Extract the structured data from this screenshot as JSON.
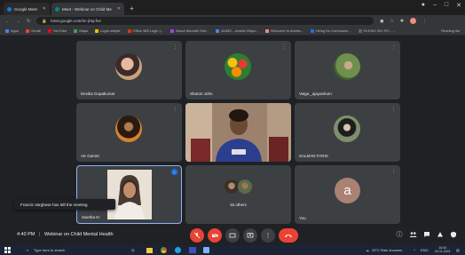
{
  "browser": {
    "tabs": [
      {
        "label": "Google Meet",
        "color": "#1a73e8"
      },
      {
        "label": "Meet - Webinar on Child Me",
        "color": "#00897b",
        "active": true
      }
    ],
    "new_tab": "+",
    "url": "meet.google.com/rtc-jhtq-fve",
    "bookmarks": [
      {
        "label": "Apps",
        "color": "#4285f4"
      },
      {
        "label": "Gmail",
        "color": "#ea4335"
      },
      {
        "label": "YouTube",
        "color": "#ff0000"
      },
      {
        "label": "Maps",
        "color": "#34a853"
      },
      {
        "label": "Login simple",
        "color": "#fbbc04"
      },
      {
        "label": "Office 365 Login |...",
        "color": "#d83b01"
      },
      {
        "label": "About Moonkit Onli...",
        "color": "#a142f4"
      },
      {
        "label": "AUMS – Amrita Vidya...",
        "color": "#4285f4"
      },
      {
        "label": "Welcome to Amrita...",
        "color": "#f28b82"
      },
      {
        "label": "Hiring for Communic...",
        "color": "#1a73e8"
      },
      {
        "label": "HI-ENG 001 IPC - ...",
        "color": "#5f6368"
      }
    ],
    "reading_list": "Reading list"
  },
  "participants": [
    {
      "name": "Devika Gopakumar"
    },
    {
      "name": "Sharon John"
    },
    {
      "name": "Vaiga _ajayashum"
    },
    {
      "name": "AK Gamer"
    },
    {
      "name": ""
    },
    {
      "name": "SALMAN FARIS"
    },
    {
      "name": "Swetha Kr"
    },
    {
      "name": "46 others"
    },
    {
      "name": "You",
      "initial": "a"
    }
  ],
  "toast": "Francis Varghese has left the meeting",
  "meeting": {
    "time": "4:40 PM",
    "separator": "|",
    "title": "Webinar on Child Mental Health"
  },
  "colors": {
    "accent": "#8ab4f8",
    "danger": "#ea4335",
    "tile": "#3c4043",
    "background": "#202124"
  },
  "taskbar": {
    "search_placeholder": "Type here to search",
    "weather": "25°C  Rain showers",
    "lang": "ENG",
    "time": "16:40",
    "date": "02-11-2021"
  }
}
